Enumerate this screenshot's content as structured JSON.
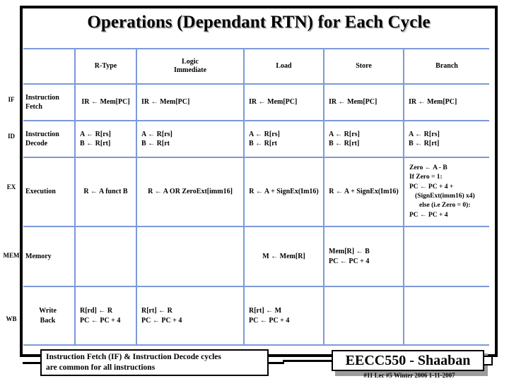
{
  "slide": {
    "title": "Operations (Dependant RTN) for Each Cycle"
  },
  "table": {
    "column_headers": [
      "",
      "R-Type",
      "Logic\nImmediate",
      "Load",
      "Store",
      "Branch"
    ],
    "header_logic_line1": "Logic",
    "header_logic_line2": "Immediate",
    "header_rtype": "R-Type",
    "header_load": "Load",
    "header_store": "Store",
    "header_branch": "Branch",
    "rows": [
      {
        "tag": "IF",
        "stage_line1": "Instruction",
        "stage_line2": "Fetch",
        "rtype": [
          "IR ← Mem[PC]"
        ],
        "logic_imm": [
          "IR ←   Mem[PC]"
        ],
        "load": [
          "IR ←   Mem[PC]"
        ],
        "store": [
          "IR ←   Mem[PC]"
        ],
        "branch": [
          "IR ←  Mem[PC]"
        ]
      },
      {
        "tag": "ID",
        "stage_line1": "Instruction",
        "stage_line2": "Decode",
        "rtype": [
          "A ←   R[rs]",
          "B ←   R[rt]"
        ],
        "logic_imm": [
          "A ←   R[rs]",
          "B ←   R[rt"
        ],
        "load": [
          "A ←   R[rs]",
          "B ←   R[rt"
        ],
        "store": [
          "A ←  R[rs]",
          "B ←  R[rt]"
        ],
        "branch": [
          "A ←   R[rs]",
          "B ←   R[rt]"
        ]
      },
      {
        "tag": "EX",
        "stage_line1": "Execution",
        "stage_line2": "",
        "rtype": [
          "R ← A funct B"
        ],
        "logic_imm": [
          "R ←  A  OR  ZeroExt[imm16]"
        ],
        "load": [
          "R ← A + SignEx(Im16)"
        ],
        "store": [
          "R ←  A + SignEx(Im16)"
        ],
        "branch": [
          "Zero ← A - B",
          "If  Zero  = 1:",
          "PC ←  PC + 4 +",
          "(SignExt(imm16) x4)",
          "else (i.e Zero = 0):",
          "PC ←   PC + 4"
        ]
      },
      {
        "tag": "MEM",
        "stage_line1": "Memory",
        "stage_line2": "",
        "rtype": [],
        "logic_imm": [],
        "load": [
          "M ←  Mem[R]"
        ],
        "store": [
          "Mem[R]  ←  B",
          "PC ←   PC + 4"
        ],
        "branch": []
      },
      {
        "tag": "WB",
        "stage_line1": "Write",
        "stage_line2": "Back",
        "rtype": [
          "R[rd] ←  R",
          "PC ←  PC + 4"
        ],
        "logic_imm": [
          "R[rt] ←  R",
          "PC ←  PC + 4"
        ],
        "load": [
          "R[rt] ←   M",
          "PC ←  PC + 4"
        ],
        "store": [],
        "branch": []
      }
    ]
  },
  "note": {
    "line1": "Instruction Fetch (IF) & Instruction Decode cycles",
    "line2": "are common for all instructions"
  },
  "footer": {
    "brand": "EECC550 - Shaaban",
    "meta": "#11   Lec #5  Winter 2006  1-11-2007"
  },
  "colors": {
    "grid_line": "#7d99d8",
    "frame": "#000000",
    "brand_shadow": "#9c9c9c",
    "text": "#000000",
    "background": "#ffffff"
  }
}
